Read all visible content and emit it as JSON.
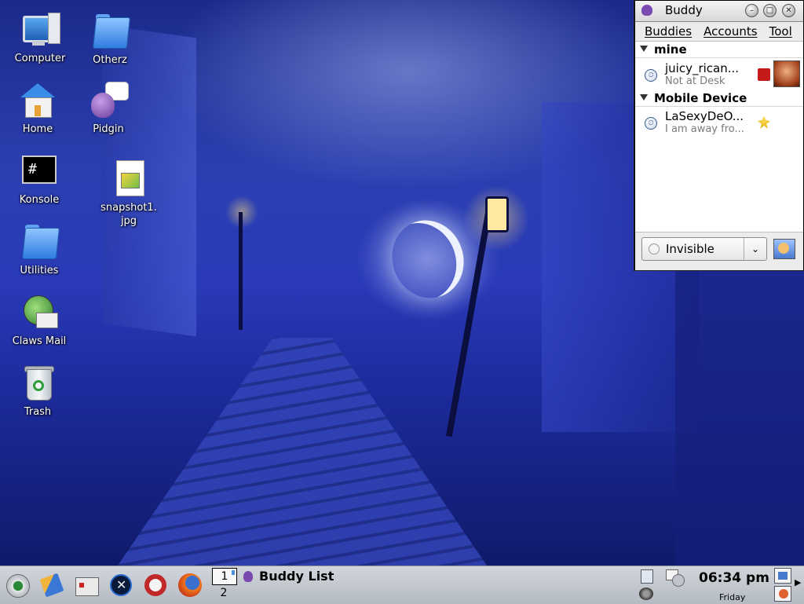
{
  "desktop": {
    "icons": [
      {
        "label": "Computer",
        "icon": "computer-icon"
      },
      {
        "label": "Otherz",
        "icon": "folder-icon"
      },
      {
        "label": "Home",
        "icon": "home-icon"
      },
      {
        "label": "Pidgin",
        "icon": "pidgin-icon"
      },
      {
        "label": "Konsole",
        "icon": "terminal-icon",
        "glyph": "#"
      },
      {
        "label": "snapshot1.",
        "label2": "jpg",
        "icon": "image-file-icon"
      },
      {
        "label": "Utilities",
        "icon": "folder-icon"
      },
      {
        "label": "Claws Mail",
        "icon": "mail-client-icon"
      },
      {
        "label": "Trash",
        "icon": "trash-icon"
      }
    ]
  },
  "buddy_window": {
    "title": "Buddy",
    "controls": {
      "minimize": "–",
      "maximize": "□",
      "close": "✕"
    },
    "menu": [
      "Buddies",
      "Accounts",
      "Tool"
    ],
    "groups": [
      {
        "name": "mine",
        "buddies": [
          {
            "name": "juicy_rican...",
            "status": "Not at Desk",
            "protocol_icon": "red-protocol-icon",
            "has_avatar": true
          }
        ]
      },
      {
        "name": "Mobile Device",
        "buddies": [
          {
            "name": "LaSexyDeO...",
            "status": "I am away fro...",
            "protocol_icon": "aim-running-man-icon",
            "has_avatar": false
          }
        ]
      }
    ],
    "status_selector": {
      "value": "Invisible",
      "arrow": "⌄"
    }
  },
  "taskbar": {
    "launchers": [
      "k-menu-icon",
      "cleaner-icon",
      "control-center-icon",
      "system-tools-icon",
      "help-icon",
      "firefox-icon"
    ],
    "pager": {
      "desktops": [
        "1",
        "2"
      ],
      "active": "1"
    },
    "task_button": {
      "label": "Buddy List",
      "icon": "pidgin-icon"
    },
    "clock": {
      "time": "06:34 pm",
      "day": "Friday"
    },
    "tray_arrow": "▶"
  },
  "colors": {
    "sky_top": "#1b2a8a",
    "sky_glow": "#a0afeb",
    "taskbar": "#c4c9d0",
    "window_bg": "#ffffff",
    "status_text_gray": "#7a7a7a"
  }
}
